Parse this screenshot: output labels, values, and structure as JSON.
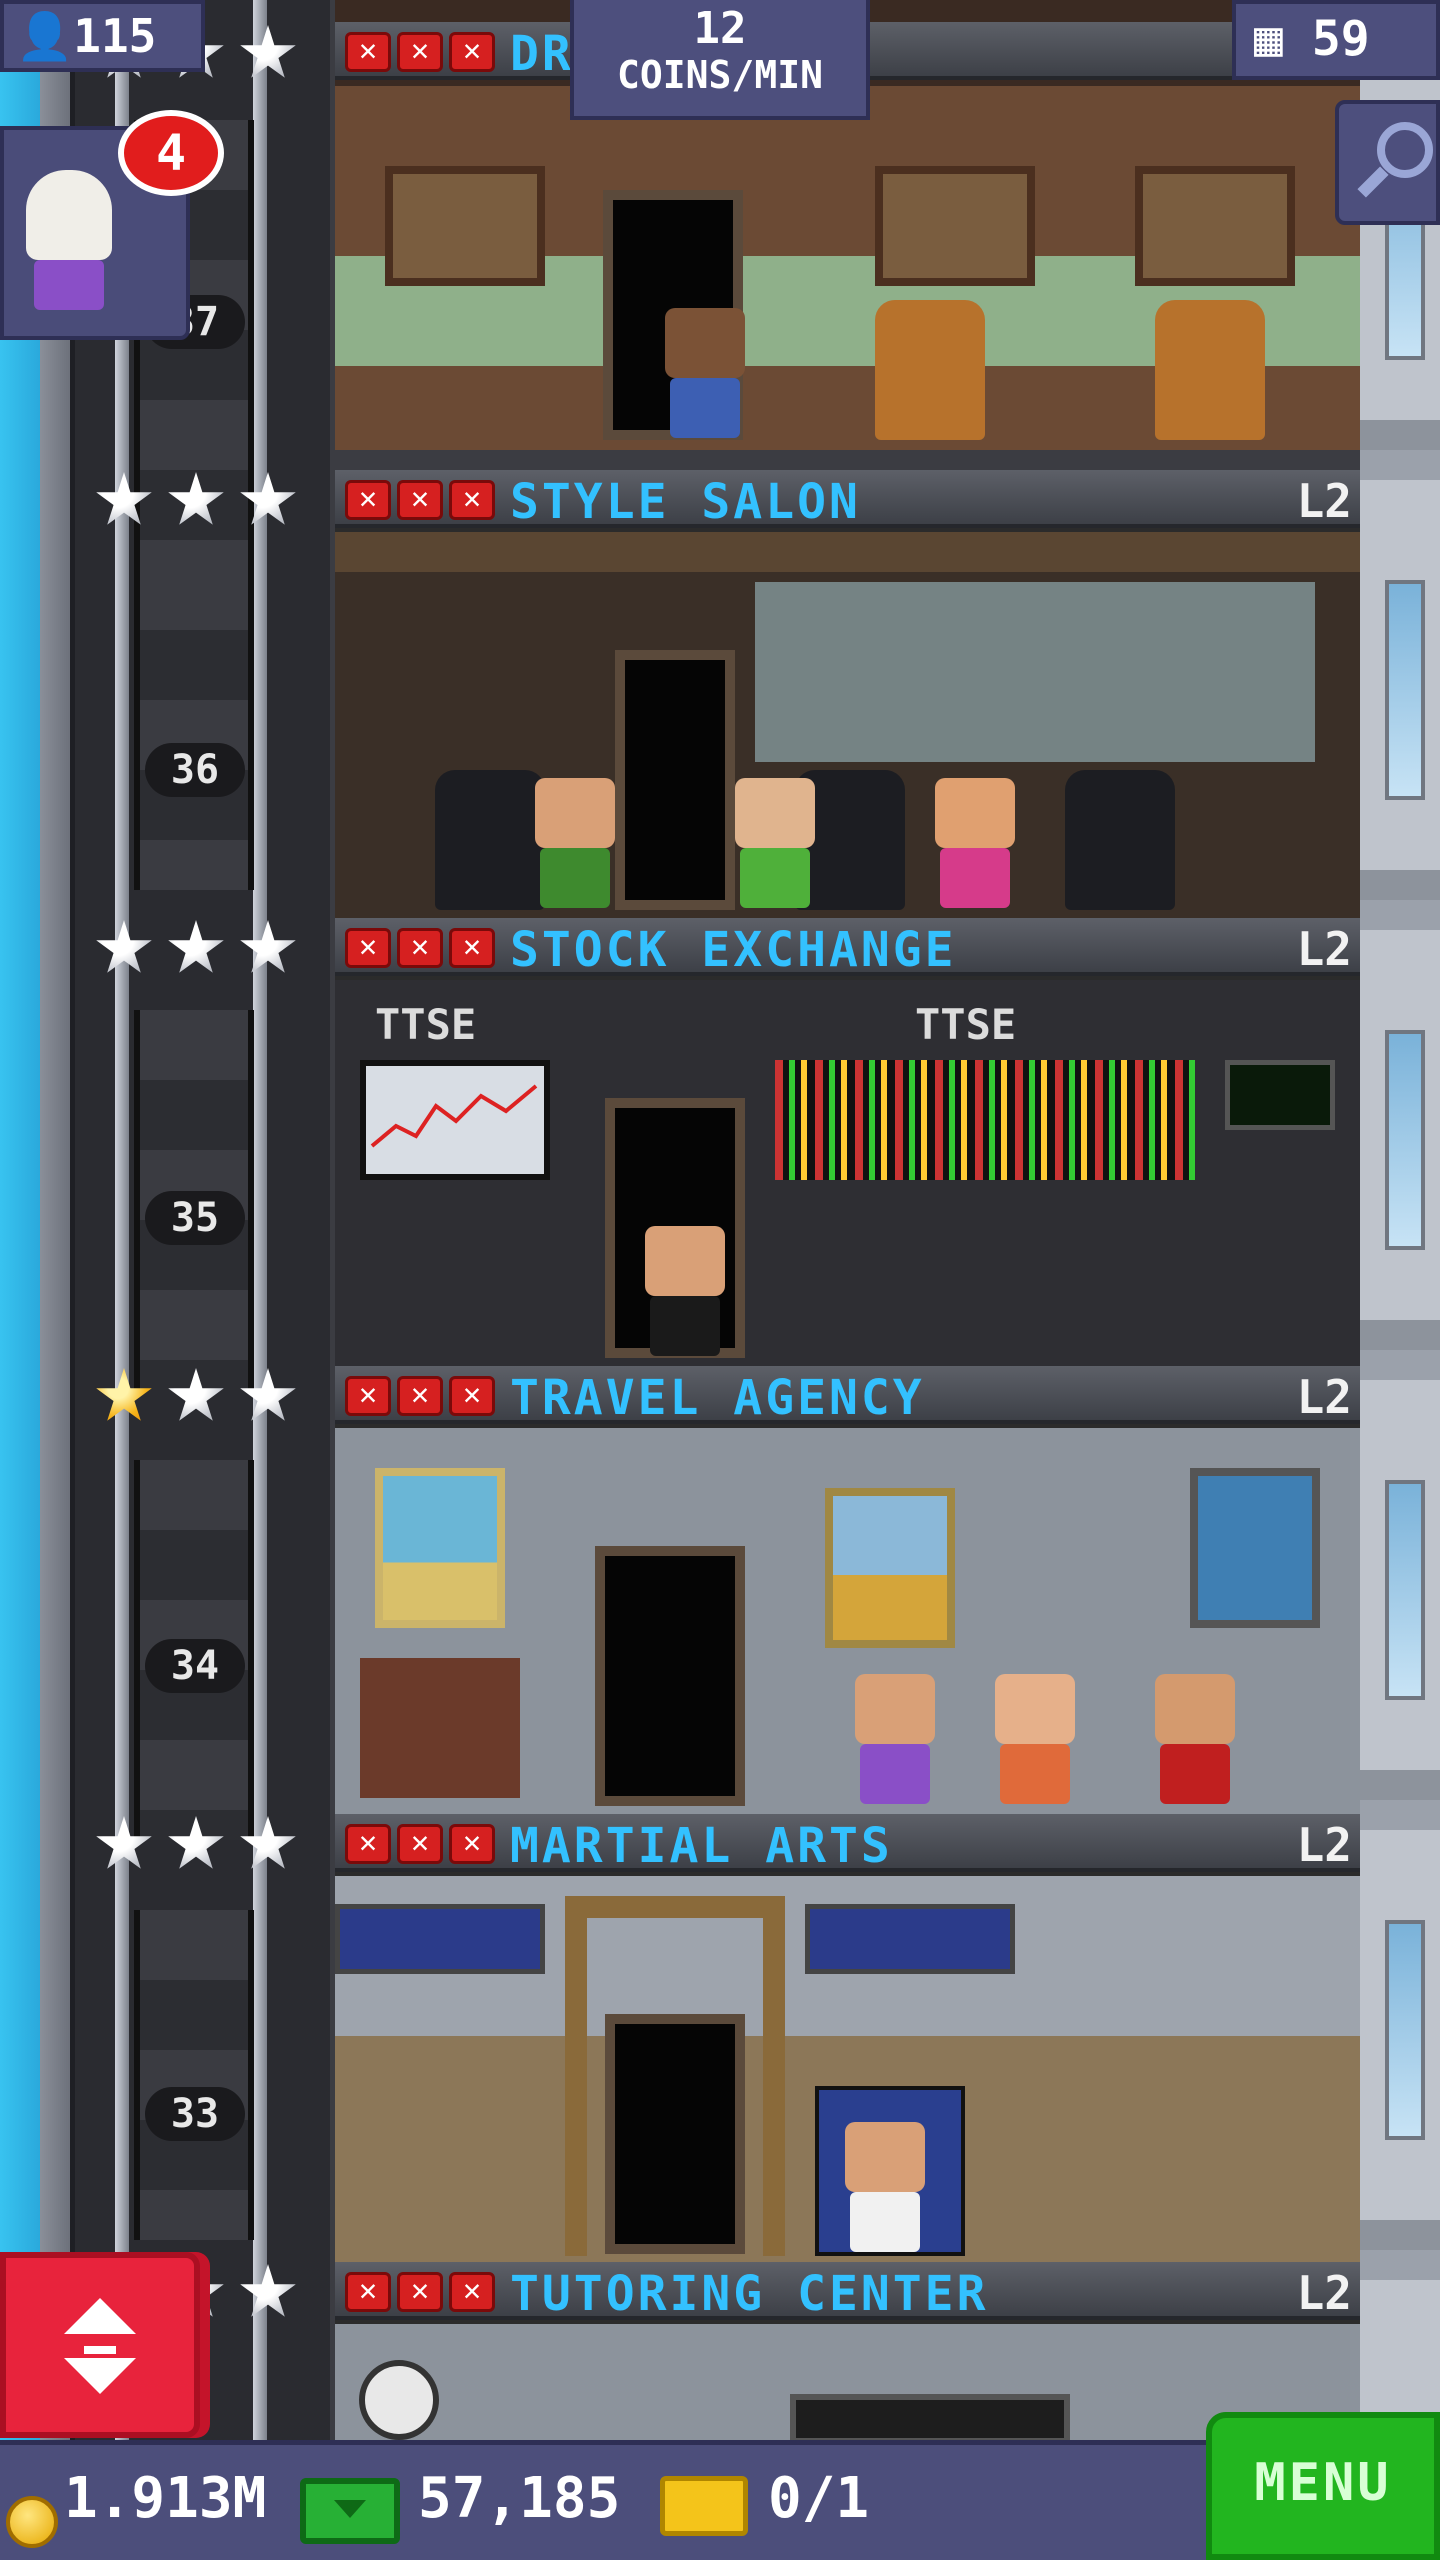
{
  "hud": {
    "population": "115",
    "coins_rate_value": "12",
    "coins_rate_unit": "COINS/MIN",
    "floor_count": "59",
    "visitor_badge": "4"
  },
  "elevator": {
    "floor_numbers": [
      "37",
      "36",
      "35",
      "34",
      "33"
    ]
  },
  "floors": [
    {
      "name": "DR",
      "level": "",
      "stars_gold": 0
    },
    {
      "name": "STYLE SALON",
      "level": "L2",
      "stars_gold": 0
    },
    {
      "name": "STOCK EXCHANGE",
      "level": "L2",
      "stars_gold": 0
    },
    {
      "name": "TRAVEL AGENCY",
      "level": "L2",
      "stars_gold": 1
    },
    {
      "name": "MARTIAL ARTS",
      "level": "L2",
      "stars_gold": 0
    },
    {
      "name": "TUTORING CENTER",
      "level": "L2",
      "stars_gold": 0
    }
  ],
  "signage": {
    "stock_sign_1": "TTSE",
    "stock_sign_2": "TTSE"
  },
  "bottom_bar": {
    "coins": "1.913M",
    "bux": "57,185",
    "tickets": "0/1",
    "menu_label": "MENU"
  },
  "colors": {
    "sign_text": "#33c1ff",
    "hud_bg": "#4d4f7d",
    "menu_green": "#22b51f",
    "elevator_button_red": "#e8233c"
  },
  "icons": [
    "person-icon",
    "building-icon",
    "zoom-out-icon",
    "coin-icon",
    "bux-icon",
    "ticket-icon",
    "elevator-updown-icon",
    "star-icon",
    "x-mark-icon"
  ]
}
